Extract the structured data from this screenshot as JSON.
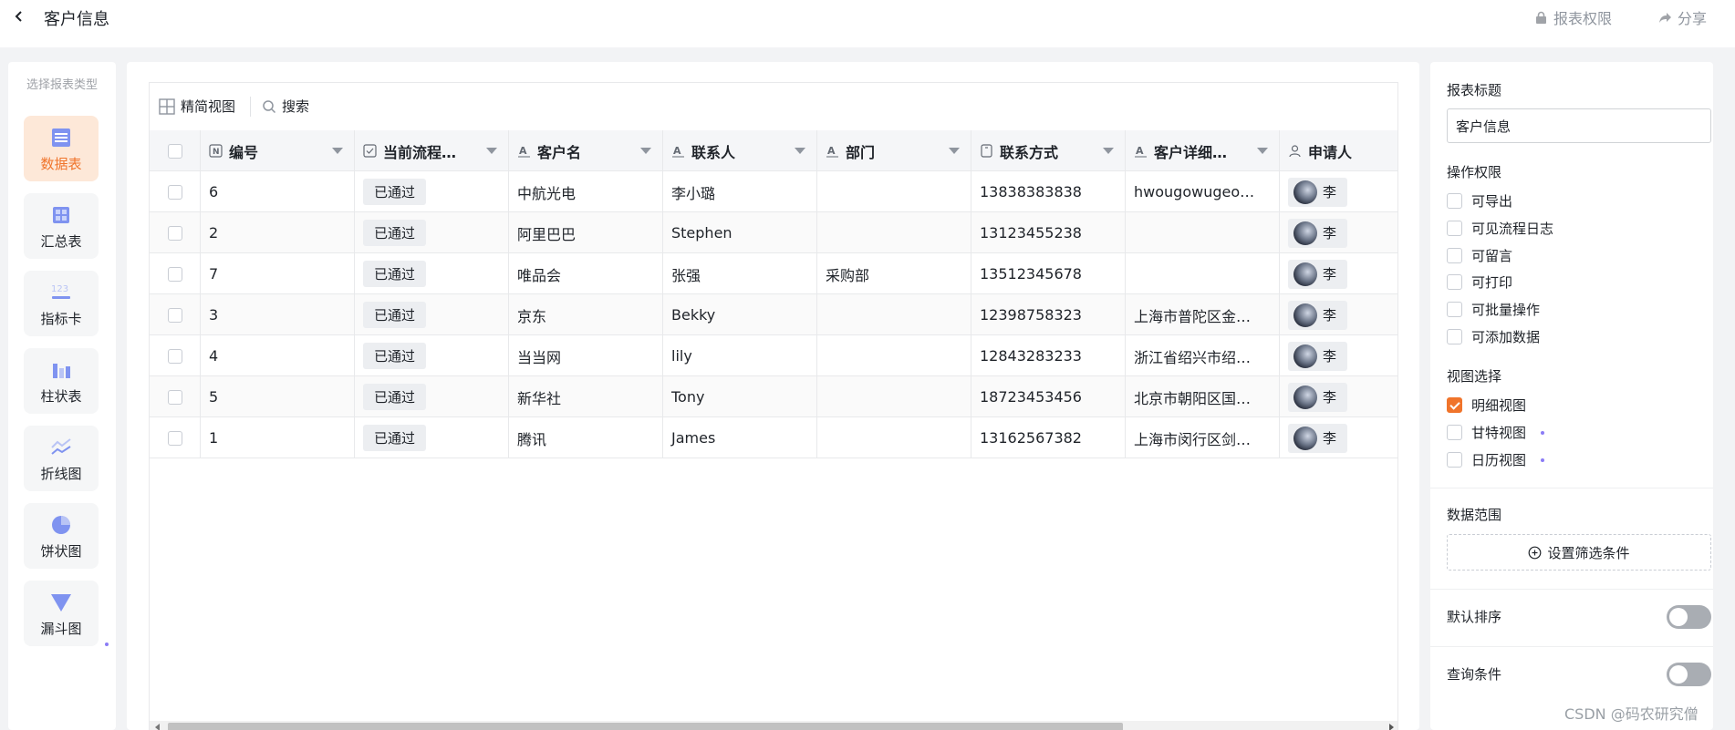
{
  "header": {
    "title": "客户信息",
    "permissions_label": "报表权限",
    "share_label": "分享"
  },
  "left_panel": {
    "title": "选择报表类型",
    "chart_types": [
      {
        "label": "数据表",
        "icon": "table-icon",
        "active": true
      },
      {
        "label": "汇总表",
        "icon": "summary-table-icon",
        "active": false
      },
      {
        "label": "指标卡",
        "icon": "metric-card-icon",
        "active": false
      },
      {
        "label": "柱状表",
        "icon": "bar-chart-icon",
        "active": false
      },
      {
        "label": "折线图",
        "icon": "line-chart-icon",
        "active": false
      },
      {
        "label": "饼状图",
        "icon": "pie-chart-icon",
        "active": false
      },
      {
        "label": "漏斗图",
        "icon": "funnel-chart-icon",
        "active": false
      }
    ]
  },
  "toolbar": {
    "compact_view_label": "精简视图",
    "search_label": "搜索"
  },
  "table": {
    "columns": [
      {
        "label": "编号",
        "icon": "number-field-icon"
      },
      {
        "label": "当前流程…",
        "icon": "checkbox-field-icon"
      },
      {
        "label": "客户名",
        "icon": "text-field-icon"
      },
      {
        "label": "联系人",
        "icon": "text-field-icon"
      },
      {
        "label": "部门",
        "icon": "text-field-icon"
      },
      {
        "label": "联系方式",
        "icon": "phone-field-icon"
      },
      {
        "label": "客户详细…",
        "icon": "text-field-icon"
      },
      {
        "label": "申请人",
        "icon": "person-field-icon"
      }
    ],
    "rows": [
      {
        "id": "6",
        "status": "已通过",
        "customer": "中航光电",
        "contact": "李小璐",
        "dept": "",
        "phone": "13838383838",
        "detail": "hwougowugeoue…",
        "applicant": "李"
      },
      {
        "id": "2",
        "status": "已通过",
        "customer": "阿里巴巴",
        "contact": "Stephen",
        "dept": "",
        "phone": "13123455238",
        "detail": "",
        "applicant": "李"
      },
      {
        "id": "7",
        "status": "已通过",
        "customer": "唯品会",
        "contact": "张强",
        "dept": "采购部",
        "phone": "13512345678",
        "detail": "",
        "applicant": "李"
      },
      {
        "id": "3",
        "status": "已通过",
        "customer": "京东",
        "contact": "Bekky",
        "dept": "",
        "phone": "12398758323",
        "detail": "上海市普陀区金山…",
        "applicant": "李"
      },
      {
        "id": "4",
        "status": "已通过",
        "customer": "当当网",
        "contact": "lily",
        "dept": "",
        "phone": "12843283233",
        "detail": "浙江省绍兴市绍兴…",
        "applicant": "李"
      },
      {
        "id": "5",
        "status": "已通过",
        "customer": "新华社",
        "contact": "Tony",
        "dept": "",
        "phone": "18723453456",
        "detail": "北京市朝阳区国北…",
        "applicant": "李"
      },
      {
        "id": "1",
        "status": "已通过",
        "customer": "腾讯",
        "contact": "James",
        "dept": "",
        "phone": "13162567382",
        "detail": "上海市闵行区剑川…",
        "applicant": "李"
      }
    ]
  },
  "right_panel": {
    "report_title_label": "报表标题",
    "report_title_value": "客户信息",
    "permissions_label": "操作权限",
    "permissions": [
      {
        "label": "可导出",
        "checked": false
      },
      {
        "label": "可见流程日志",
        "checked": false
      },
      {
        "label": "可留言",
        "checked": false
      },
      {
        "label": "可打印",
        "checked": false
      },
      {
        "label": "可批量操作",
        "checked": false
      },
      {
        "label": "可添加数据",
        "checked": false
      }
    ],
    "view_label": "视图选择",
    "views": [
      {
        "label": "明细视图",
        "checked": true
      },
      {
        "label": "甘特视图",
        "checked": false
      },
      {
        "label": "日历视图",
        "checked": false
      }
    ],
    "data_range_label": "数据范围",
    "filter_button_label": "设置筛选条件",
    "default_sort_label": "默认排序",
    "default_sort_on": false,
    "query_condition_label": "查询条件",
    "query_condition_on": false
  },
  "watermark": "CSDN @码农研究僧",
  "colors": {
    "accent": "#f0742b",
    "accent_bg": "#fde8d8",
    "pro_dot": "#8b7cf6"
  }
}
